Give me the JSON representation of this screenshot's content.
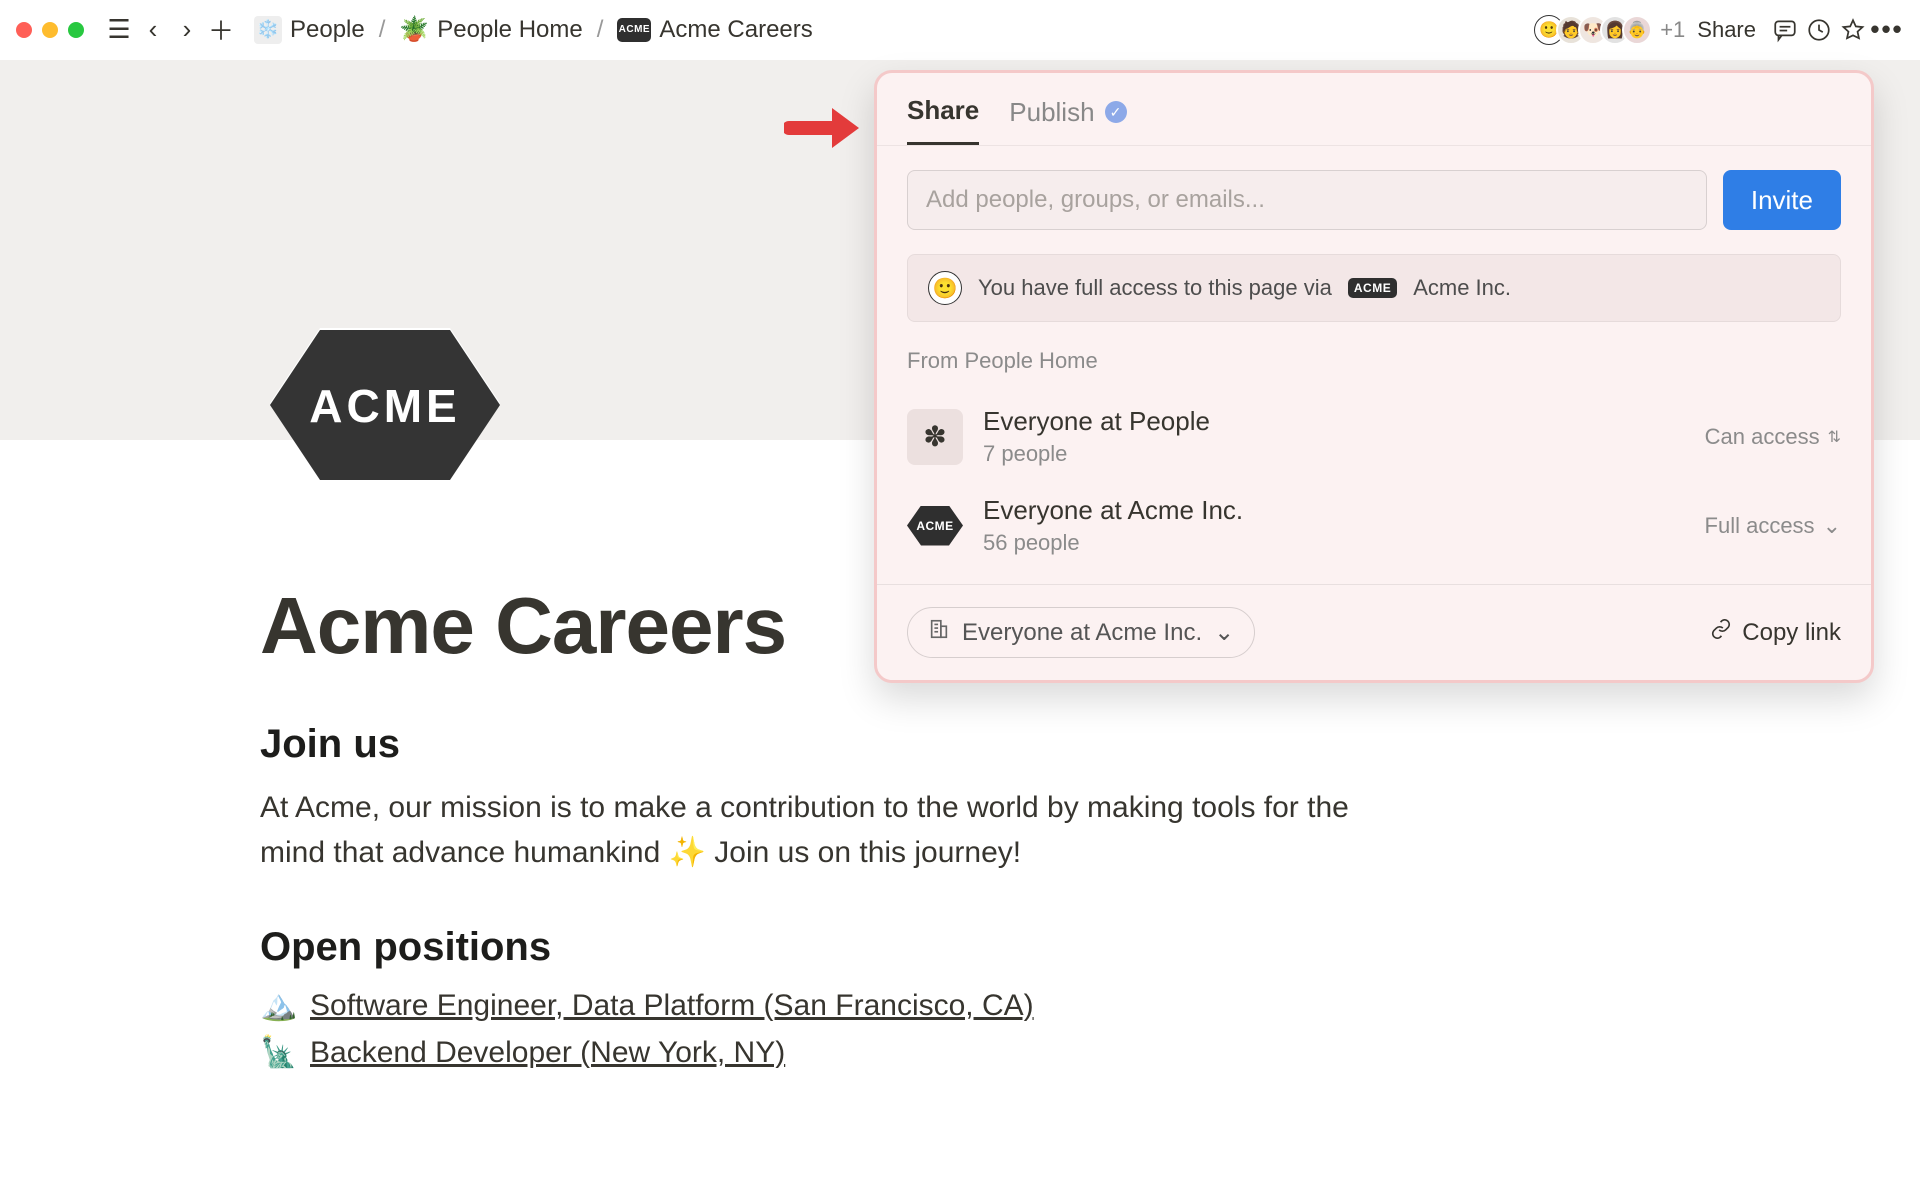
{
  "topbar": {
    "breadcrumb": [
      {
        "icon": "❄️",
        "label": "People"
      },
      {
        "icon": "🪴",
        "label": "People Home"
      },
      {
        "icon": "ACME",
        "label": "Acme Careers"
      }
    ],
    "avatar_overflow": "+1",
    "share_label": "Share"
  },
  "page": {
    "title": "Acme Careers",
    "h2_join": "Join us",
    "intro": "At Acme, our mission is to make a contribution to the world by making tools for the mind that advance humankind ✨ Join us on this journey!",
    "h2_positions": "Open positions",
    "positions": [
      {
        "emoji": "🏔️",
        "label": "Software Engineer, Data Platform (San Francisco, CA)"
      },
      {
        "emoji": "🗽",
        "label": "Backend Developer (New York, NY)"
      }
    ]
  },
  "share_panel": {
    "tabs": {
      "share": "Share",
      "publish": "Publish"
    },
    "input_placeholder": "Add people, groups, or emails...",
    "invite_label": "Invite",
    "access_note_prefix": "You have full access to this page via",
    "access_note_org": "Acme Inc.",
    "section_title": "From People Home",
    "rows": [
      {
        "icon": "✽",
        "name": "Everyone at People",
        "sub": "7 people",
        "perm": "Can access",
        "chevron": "⇅"
      },
      {
        "icon": "ACME",
        "name": "Everyone at Acme Inc.",
        "sub": "56 people",
        "perm": "Full access",
        "chevron": "⌄"
      }
    ],
    "scope_label": "Everyone at Acme Inc.",
    "copy_link_label": "Copy link"
  }
}
